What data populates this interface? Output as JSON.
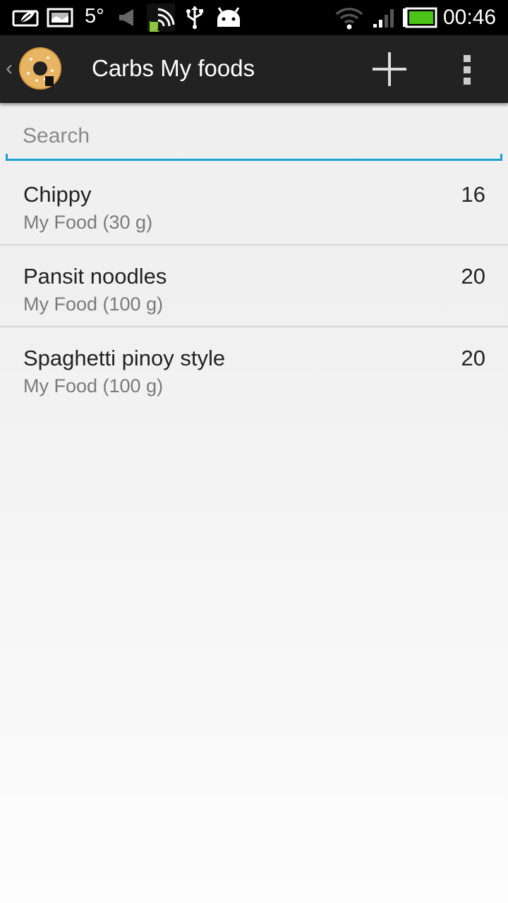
{
  "status_bar": {
    "temperature": "5°",
    "time": "00:46",
    "icons": [
      "leaf-notification-icon",
      "image-notification-icon",
      "mute-icon",
      "android-cast-icon",
      "usb-icon",
      "android-debug-icon",
      "wifi-icon",
      "signal-icon",
      "battery-icon"
    ],
    "battery_color": "#4cc417"
  },
  "action_bar": {
    "title": "Carbs My foods",
    "up_icon": "chevron-left-icon",
    "app_icon": "donut-icon",
    "add_icon": "plus-icon",
    "overflow_icon": "more-vert-icon"
  },
  "search": {
    "placeholder": "Search",
    "value": "",
    "accent": "#1ea0cf"
  },
  "foods": [
    {
      "name": "Chippy",
      "detail": "My Food (30 g)",
      "carbs": "16"
    },
    {
      "name": "Pansit noodles",
      "detail": "My Food (100 g)",
      "carbs": "20"
    },
    {
      "name": "Spaghetti pinoy style",
      "detail": "My Food (100 g)",
      "carbs": "20"
    }
  ]
}
